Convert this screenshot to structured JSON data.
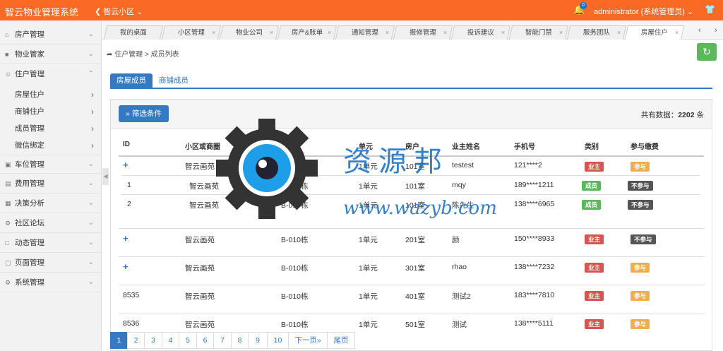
{
  "app": {
    "title": "智云物业管理系统",
    "community": "智云小区",
    "notification_count": "0",
    "user": "administrator (系统管理员)"
  },
  "sidebar": {
    "items": [
      {
        "label": "房产管理",
        "icon": "home-icon"
      },
      {
        "label": "物业管家",
        "icon": "building-icon"
      },
      {
        "label": "住户管理",
        "icon": "user-icon"
      },
      {
        "label": "车位管理",
        "icon": "car-icon"
      },
      {
        "label": "费用管理",
        "icon": "fee-icon"
      },
      {
        "label": "决策分析",
        "icon": "chart-icon"
      },
      {
        "label": "社区论坛",
        "icon": "forum-icon"
      },
      {
        "label": "动态管理",
        "icon": "news-icon"
      },
      {
        "label": "页面管理",
        "icon": "page-icon"
      },
      {
        "label": "系统管理",
        "icon": "gear-icon"
      }
    ],
    "subitems": [
      "房屋住户",
      "商铺住户",
      "成员管理",
      "微信绑定"
    ]
  },
  "tabs": [
    "我的桌面",
    "小区管理",
    "物业公司",
    "房产&账单",
    "通知管理",
    "报修管理",
    "投诉建议",
    "智能门禁",
    "服务团队",
    "房屋住户"
  ],
  "breadcrumb": "住户管理 > 成员列表",
  "subtabs": [
    "房屋成员",
    "商铺成员"
  ],
  "filter_button": "筛选条件",
  "total": {
    "prefix": "共有数据：",
    "count": "2202",
    "suffix": " 条"
  },
  "table": {
    "headers": [
      "ID",
      "小区或商圈",
      "栋宇",
      "单元",
      "房户",
      "业主姓名",
      "手机号",
      "类别",
      "参与缴费"
    ],
    "rows": [
      {
        "id": "+",
        "community": "智云画苑",
        "building": "B-010栋",
        "unit": "1单元",
        "room": "101室",
        "name": "testest",
        "phone": "121****2",
        "type": "业主",
        "pay": "参与"
      },
      {
        "id": "1",
        "community": "智云画苑",
        "building": "B-010栋",
        "unit": "1单元",
        "room": "101室",
        "name": "mqy",
        "phone": "189****1211",
        "type": "成员",
        "pay": "不参与"
      },
      {
        "id": "2",
        "community": "智云画苑",
        "building": "B-010栋",
        "unit": "1单元",
        "room": "101室",
        "name": "陈先生",
        "phone": "138****6965",
        "type": "成员",
        "pay": "不参与"
      },
      {
        "id": "+",
        "community": "智云画苑",
        "building": "B-010栋",
        "unit": "1单元",
        "room": "201室",
        "name": "颜",
        "phone": "150****8933",
        "type": "业主",
        "pay": "不参与"
      },
      {
        "id": "+",
        "community": "智云画苑",
        "building": "B-010栋",
        "unit": "1单元",
        "room": "301室",
        "name": "rhao",
        "phone": "138****7232",
        "type": "业主",
        "pay": "参与"
      },
      {
        "id": "8535",
        "community": "智云画苑",
        "building": "B-010栋",
        "unit": "1单元",
        "room": "401室",
        "name": "测试2",
        "phone": "183****7810",
        "type": "业主",
        "pay": "参与"
      },
      {
        "id": "8536",
        "community": "智云画苑",
        "building": "B-010栋",
        "unit": "1单元",
        "room": "501室",
        "name": "测试",
        "phone": "138****5111",
        "type": "业主",
        "pay": "参与"
      }
    ]
  },
  "pagination": [
    "1",
    "2",
    "3",
    "4",
    "5",
    "6",
    "7",
    "8",
    "9",
    "10",
    "下一页»",
    "尾页"
  ],
  "watermark": {
    "title": "资源邦",
    "url": "www.wazyb.com"
  },
  "colors": {
    "topbar": "#fb6a24",
    "primary": "#3479c1",
    "owner": "#d9534f",
    "member": "#5cb85c",
    "join": "#f0ad4e",
    "nojoin": "#555555",
    "refresh": "#5cb85c"
  }
}
